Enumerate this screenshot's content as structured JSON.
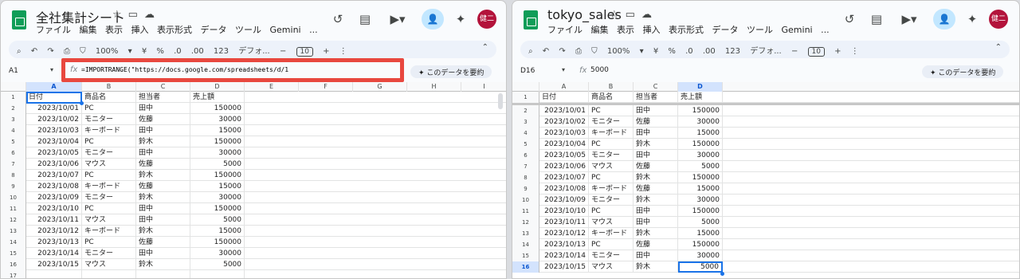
{
  "left": {
    "doc_title": "全社集計シート",
    "menu": [
      "ファイル",
      "編集",
      "表示",
      "挿入",
      "表示形式",
      "データ",
      "ツール",
      "Gemini",
      "..."
    ],
    "toolbar": {
      "zoom": "100%",
      "currency": "¥",
      "percent": "%",
      "dec_less": ".0",
      "dec_more": ".00",
      "number_fmt": "123",
      "font": "デフォ...",
      "font_size": "10"
    },
    "name_box": "A1",
    "fx_label": "fx",
    "formula": "=IMPORTRANGE(\"https://docs.google.com/spreadsheets/d/1",
    "summarize_label": "✦ このデータを要約",
    "columns": [
      "A",
      "B",
      "C",
      "D",
      "E",
      "F",
      "G",
      "H",
      "I"
    ],
    "header_row": [
      "日付",
      "商品名",
      "担当者",
      "売上額"
    ],
    "rows": [
      [
        "2023/10/01",
        "PC",
        "田中",
        "150000"
      ],
      [
        "2023/10/02",
        "モニター",
        "佐藤",
        "30000"
      ],
      [
        "2023/10/03",
        "キーボード",
        "田中",
        "15000"
      ],
      [
        "2023/10/04",
        "PC",
        "鈴木",
        "150000"
      ],
      [
        "2023/10/05",
        "モニター",
        "田中",
        "30000"
      ],
      [
        "2023/10/06",
        "マウス",
        "佐藤",
        "5000"
      ],
      [
        "2023/10/07",
        "PC",
        "鈴木",
        "150000"
      ],
      [
        "2023/10/08",
        "キーボード",
        "佐藤",
        "15000"
      ],
      [
        "2023/10/09",
        "モニター",
        "鈴木",
        "30000"
      ],
      [
        "2023/10/10",
        "PC",
        "田中",
        "150000"
      ],
      [
        "2023/10/11",
        "マウス",
        "田中",
        "5000"
      ],
      [
        "2023/10/12",
        "キーボード",
        "鈴木",
        "15000"
      ],
      [
        "2023/10/13",
        "PC",
        "佐藤",
        "150000"
      ],
      [
        "2023/10/14",
        "モニター",
        "田中",
        "30000"
      ],
      [
        "2023/10/15",
        "マウス",
        "鈴木",
        "5000"
      ]
    ],
    "row_numbers": [
      "1",
      "2",
      "3",
      "4",
      "5",
      "6",
      "7",
      "8",
      "9",
      "10",
      "11",
      "12",
      "13",
      "14",
      "15",
      "16",
      "17"
    ]
  },
  "right": {
    "doc_title": "tokyo_sales",
    "menu": [
      "ファイル",
      "編集",
      "表示",
      "挿入",
      "表示形式",
      "データ",
      "ツール",
      "Gemini",
      "..."
    ],
    "toolbar": {
      "zoom": "100%",
      "currency": "¥",
      "percent": "%",
      "dec_less": ".0",
      "dec_more": ".00",
      "number_fmt": "123",
      "font": "デフォ...",
      "font_size": "10"
    },
    "name_box": "D16",
    "fx_label": "fx",
    "formula": "5000",
    "summarize_label": "✦ このデータを要約",
    "columns": [
      "A",
      "B",
      "C",
      "D"
    ],
    "header_row": [
      "日付",
      "商品名",
      "担当者",
      "売上額"
    ],
    "rows": [
      [
        "2023/10/01",
        "PC",
        "田中",
        "150000"
      ],
      [
        "2023/10/02",
        "モニター",
        "佐藤",
        "30000"
      ],
      [
        "2023/10/03",
        "キーボード",
        "田中",
        "15000"
      ],
      [
        "2023/10/04",
        "PC",
        "鈴木",
        "150000"
      ],
      [
        "2023/10/05",
        "モニター",
        "田中",
        "30000"
      ],
      [
        "2023/10/06",
        "マウス",
        "佐藤",
        "5000"
      ],
      [
        "2023/10/07",
        "PC",
        "鈴木",
        "150000"
      ],
      [
        "2023/10/08",
        "キーボード",
        "佐藤",
        "15000"
      ],
      [
        "2023/10/09",
        "モニター",
        "鈴木",
        "30000"
      ],
      [
        "2023/10/10",
        "PC",
        "田中",
        "150000"
      ],
      [
        "2023/10/11",
        "マウス",
        "田中",
        "5000"
      ],
      [
        "2023/10/12",
        "キーボード",
        "鈴木",
        "15000"
      ],
      [
        "2023/10/13",
        "PC",
        "佐藤",
        "150000"
      ],
      [
        "2023/10/14",
        "モニター",
        "田中",
        "30000"
      ],
      [
        "2023/10/15",
        "マウス",
        "鈴木",
        "5000"
      ]
    ],
    "row_numbers": [
      "1",
      "2",
      "3",
      "4",
      "5",
      "6",
      "7",
      "8",
      "9",
      "10",
      "11",
      "12",
      "13",
      "14",
      "15",
      "16"
    ]
  },
  "avatar_text": "健二",
  "icons": [
    "star-icon",
    "move-to-folder-icon",
    "cloud-status-icon",
    "history-icon",
    "comment-icon",
    "meet-icon",
    "share-person-icon",
    "gemini-spark-icon",
    "search-menu-icon",
    "undo-icon",
    "redo-icon",
    "print-icon",
    "paint-format-icon"
  ],
  "colors": {
    "highlight": "#e8483f",
    "selection": "#1a73e8",
    "sheets_green": "#0f9d58",
    "share": "#c2e7ff",
    "avatar": "#b3133b"
  }
}
